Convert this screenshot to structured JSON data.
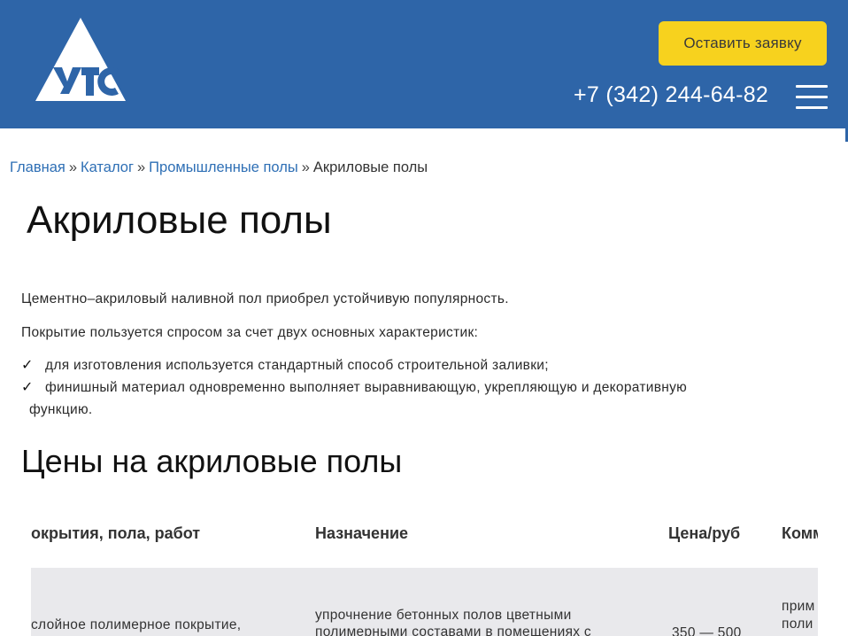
{
  "header": {
    "logo_alt": "УТС",
    "cta_label": "Оставить заявку",
    "phone": "+7 (342) 244-64-82",
    "colors": {
      "header_bg": "#2e65a8",
      "cta_bg": "#f7d21e"
    }
  },
  "breadcrumb": {
    "items": [
      "Главная",
      "Каталог",
      "Промышленные полы"
    ],
    "separator": "»",
    "current": "Акриловые полы"
  },
  "page": {
    "title": "Акриловые полы",
    "intro": "Цементно–акриловый наливной пол приобрел устойчивую популярность.",
    "lead": "Покрытие пользуется спросом за счет двух основных характеристик:",
    "check_icon": "✓",
    "list": [
      {
        "text": "для изготовления используется стандартный способ строительной заливки;"
      },
      {
        "text": "финишный материал одновременно выполняет выравнивающую, укрепляющую и декоративную",
        "cont": "функцию."
      }
    ],
    "subtitle": "Цены на акриловые полы"
  },
  "table": {
    "headers": [
      "окрытия, пола, работ",
      "Назначение",
      "Цена/руб",
      "Комм"
    ],
    "rows": [
      {
        "name": "слойное полимерное покрытие,",
        "purpose_l1": "упрочнение бетонных полов цветными",
        "purpose_l2": "полимерными составами в помещениях с",
        "price": "350 — 500",
        "comment_l1": "прим",
        "comment_l2": "поли"
      }
    ]
  }
}
